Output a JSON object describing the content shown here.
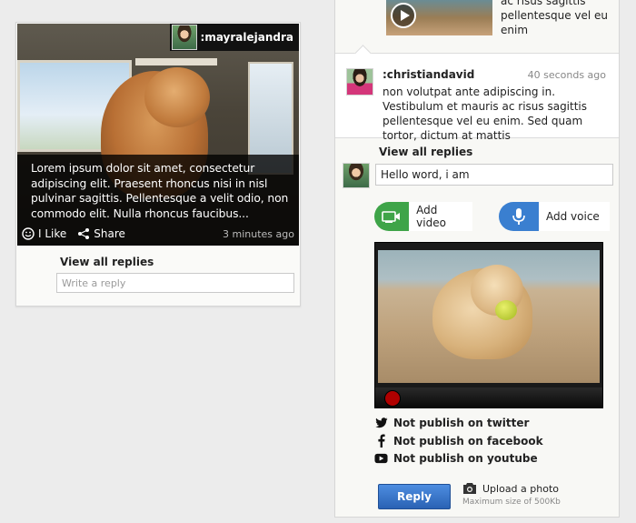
{
  "left_card": {
    "username": ":mayralejandra",
    "caption": "Lorem ipsum dolor sit amet, consectetur adipiscing elit. Praesent rhoncus nisi in nisl pulvinar sagittis. Pellentesque a velit odio, non commodo elit. Nulla rhoncus faucibus...",
    "like_label": "I Like",
    "share_label": "Share",
    "time": "3 minutes ago",
    "view_replies": "View all replies",
    "reply_placeholder": "Write a reply"
  },
  "right_panel": {
    "top_post_text": "ac risus sagittis pellentesque vel eu enim",
    "comment": {
      "username": ":christiandavid",
      "time": "40 seconds ago",
      "text": "non volutpat ante adipiscing in. Vestibulum et mauris ac risus sagittis pellentesque vel eu enim. Sed quam tortor, dictum at mattis"
    },
    "view_replies": "View all replies",
    "reply_value": "Hello word, i am",
    "add_video": "Add video",
    "add_voice": "Add voice",
    "publish": [
      {
        "icon": "twitter-icon",
        "label": "Not publish on twitter"
      },
      {
        "icon": "facebook-icon",
        "label": "Not publish on facebook"
      },
      {
        "icon": "youtube-icon",
        "label": "Not publish on youtube"
      }
    ],
    "reply_button": "Reply",
    "upload_label": "Upload a photo",
    "upload_hint": "Maximum size of 500Kb"
  },
  "colors": {
    "video_green": "#3ea448",
    "voice_blue": "#3a7fd0",
    "reply_blue": "#2f6fc4",
    "record_red": "#b00000"
  }
}
